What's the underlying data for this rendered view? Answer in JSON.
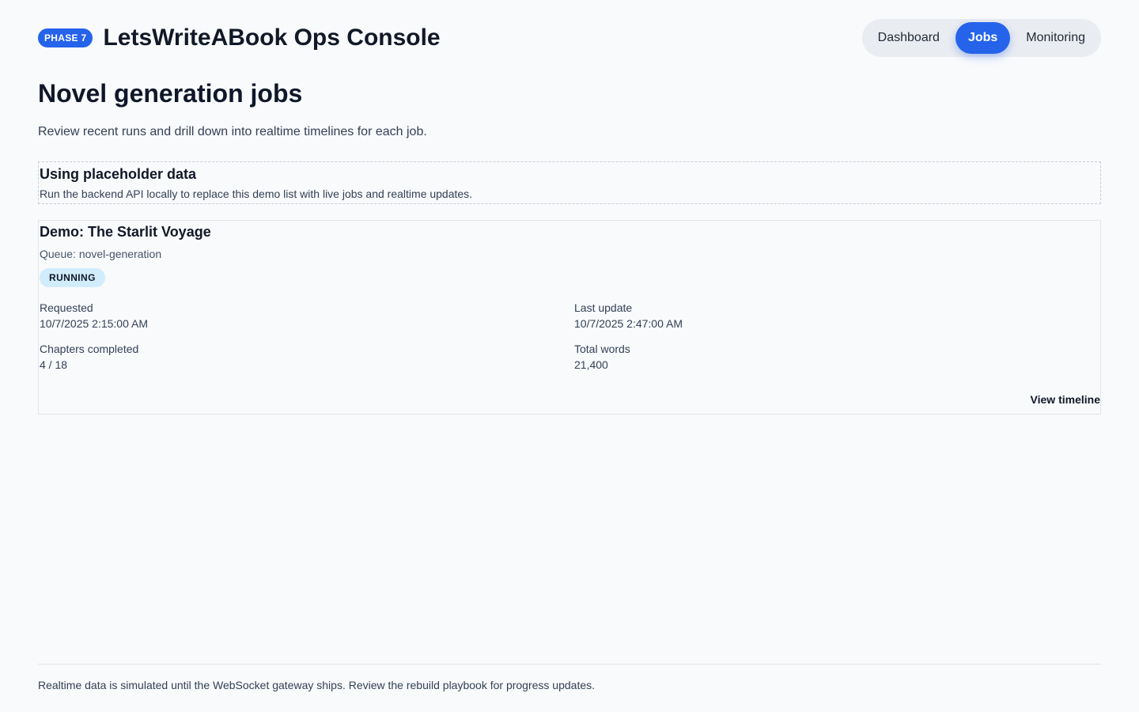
{
  "header": {
    "phase_badge": "PHASE 7",
    "app_title": "LetsWriteABook Ops Console",
    "nav": [
      {
        "label": "Dashboard",
        "active": false
      },
      {
        "label": "Jobs",
        "active": true
      },
      {
        "label": "Monitoring",
        "active": false
      }
    ]
  },
  "page": {
    "title": "Novel generation jobs",
    "subtitle": "Review recent runs and drill down into realtime timelines for each job."
  },
  "notice": {
    "title": "Using placeholder data",
    "text": "Run the backend API locally to replace this demo list with live jobs and realtime updates."
  },
  "job": {
    "title": "Demo: The Starlit Voyage",
    "queue": "Queue: novel-generation",
    "status": "RUNNING",
    "requested_label": "Requested",
    "requested_value": "10/7/2025 2:15:00 AM",
    "last_update_label": "Last update",
    "last_update_value": "10/7/2025 2:47:00 AM",
    "chapters_label": "Chapters completed",
    "chapters_value": "4 / 18",
    "words_label": "Total words",
    "words_value": "21,400",
    "view_link": "View timeline"
  },
  "footer": {
    "text": "Realtime data is simulated until the WebSocket gateway ships. Review the rebuild playbook for progress updates."
  },
  "colors": {
    "accent": "#2563eb",
    "background": "#f8fafc",
    "status_running_bg": "#d1ecfa"
  }
}
